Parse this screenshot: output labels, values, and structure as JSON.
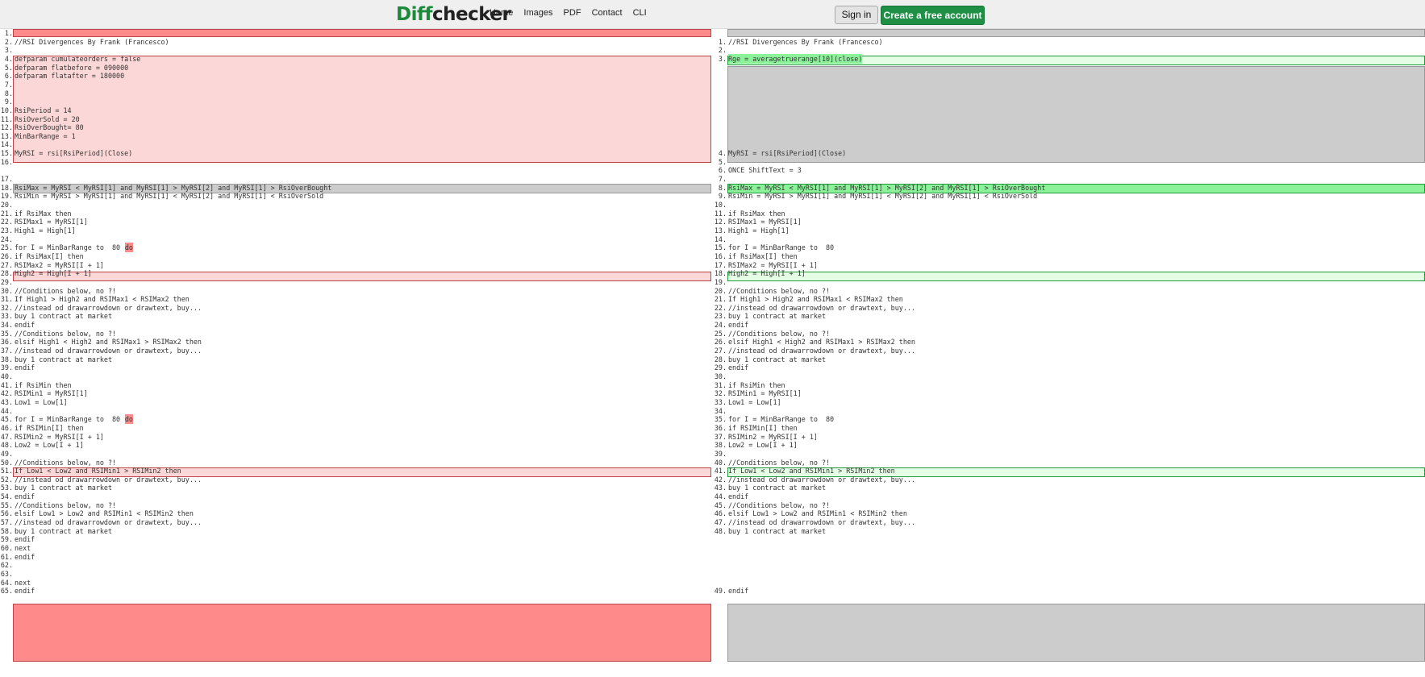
{
  "header": {
    "logo_part1": "Diff",
    "logo_part2": "checker",
    "nav": [
      "Home",
      "Images",
      "PDF",
      "Contact",
      "CLI"
    ],
    "signin_label": "Sign in",
    "create_label": "Create a free account"
  },
  "left_lines": [
    {
      "n": "1.",
      "t": ""
    },
    {
      "n": "2.",
      "t": "//RSI Divergences By Frank (Francesco)"
    },
    {
      "n": "3.",
      "t": ""
    },
    {
      "n": "4.",
      "t": "defparam cumulateorders = false"
    },
    {
      "n": "5.",
      "t": "defparam flatbefore = 090000"
    },
    {
      "n": "6.",
      "t": "defparam flatafter = 180000"
    },
    {
      "n": "7.",
      "t": ""
    },
    {
      "n": "8.",
      "t": ""
    },
    {
      "n": "9.",
      "t": ""
    },
    {
      "n": "10.",
      "t": "RsiPeriod = 14"
    },
    {
      "n": "11.",
      "t": "RsiOverSold = 20"
    },
    {
      "n": "12.",
      "t": "RsiOverBought= 80"
    },
    {
      "n": "13.",
      "t": "MinBarRange = 1"
    },
    {
      "n": "14.",
      "t": ""
    },
    {
      "n": "15.",
      "t": "MyRSI = rsi[RsiPeriod](Close)"
    },
    {
      "n": "16.",
      "t": ""
    },
    {
      "n": "",
      "t": ""
    },
    {
      "n": "17.",
      "t": ""
    },
    {
      "n": "18.",
      "t": "RsiMax = MyRSI < MyRSI[1] and MyRSI[1] > MyRSI[2] and MyRSI[1] > RsiOverBought"
    },
    {
      "n": "19.",
      "t": "RsiMin = MyRSI > MyRSI[1] and MyRSI[1] < MyRSI[2] and MyRSI[1] < RsiOverSold"
    },
    {
      "n": "20.",
      "t": ""
    },
    {
      "n": "21.",
      "t": "if RsiMax then"
    },
    {
      "n": "22.",
      "t": "RSIMax1 = MyRSI[1]"
    },
    {
      "n": "23.",
      "t": "High1 = High[1]"
    },
    {
      "n": "24.",
      "t": ""
    },
    {
      "n": "25.",
      "t": "for I = MinBarRange to  80 ",
      "hl": "do"
    },
    {
      "n": "26.",
      "t": "if RsiMax[I] then"
    },
    {
      "n": "27.",
      "t": "RSIMax2 = MyRSI[I + 1]"
    },
    {
      "n": "28.",
      "t": "High2 = High[I + 1]"
    },
    {
      "n": "29.",
      "t": ""
    },
    {
      "n": "30.",
      "t": "//Conditions below, no ?!"
    },
    {
      "n": "31.",
      "t": "If High1 > High2 and RSIMax1 < RSIMax2 then"
    },
    {
      "n": "32.",
      "t": "//instead od drawarrowdown or drawtext, buy..."
    },
    {
      "n": "33.",
      "t": "buy 1 contract at market"
    },
    {
      "n": "34.",
      "t": "endif"
    },
    {
      "n": "35.",
      "t": "//Conditions below, no ?!"
    },
    {
      "n": "36.",
      "t": "elsif High1 < High2 and RSIMax1 > RSIMax2 then"
    },
    {
      "n": "37.",
      "t": "//instead od drawarrowdown or drawtext, buy..."
    },
    {
      "n": "38.",
      "t": "buy 1 contract at market"
    },
    {
      "n": "39.",
      "t": "endif"
    },
    {
      "n": "40.",
      "t": ""
    },
    {
      "n": "41.",
      "t": "if RsiMin then"
    },
    {
      "n": "42.",
      "t": "RSIMin1 = MyRSI[1]"
    },
    {
      "n": "43.",
      "t": "Low1 = Low[1]"
    },
    {
      "n": "44.",
      "t": ""
    },
    {
      "n": "45.",
      "t": "for I = MinBarRange to  80 ",
      "hl": "do"
    },
    {
      "n": "46.",
      "t": "if RSIMin[I] then"
    },
    {
      "n": "47.",
      "t": "RSIMin2 = MyRSI[I + 1]"
    },
    {
      "n": "48.",
      "t": "Low2 = Low[I + 1]"
    },
    {
      "n": "49.",
      "t": ""
    },
    {
      "n": "50.",
      "t": "//Conditions below, no ?!"
    },
    {
      "n": "51.",
      "t": "If Low1 < Low2 and RSIMin1 > RSIMin2 then"
    },
    {
      "n": "52.",
      "t": "//instead od drawarrowdown or drawtext, buy..."
    },
    {
      "n": "53.",
      "t": "buy 1 contract at market"
    },
    {
      "n": "54.",
      "t": "endif"
    },
    {
      "n": "55.",
      "t": "//Conditions below, no ?!"
    },
    {
      "n": "56.",
      "t": "elsif Low1 > Low2 and RSIMin1 < RSIMin2 then"
    },
    {
      "n": "57.",
      "t": "//instead od drawarrowdown or drawtext, buy..."
    },
    {
      "n": "58.",
      "t": "buy 1 contract at market"
    },
    {
      "n": "59.",
      "t": "endif"
    },
    {
      "n": "60.",
      "t": "next"
    },
    {
      "n": "61.",
      "t": "endif"
    },
    {
      "n": "62.",
      "t": ""
    },
    {
      "n": "63.",
      "t": ""
    },
    {
      "n": "64.",
      "t": "next"
    },
    {
      "n": "65.",
      "t": "endif"
    }
  ],
  "right_lines": [
    {
      "n": "",
      "t": ""
    },
    {
      "n": "1.",
      "t": "//RSI Divergences By Frank (Francesco)"
    },
    {
      "n": "2.",
      "t": ""
    },
    {
      "n": "3.",
      "t": "",
      "hl": "Rge = averagetruerange[10](close)"
    },
    {
      "n": "",
      "t": ""
    },
    {
      "n": "",
      "t": ""
    },
    {
      "n": "",
      "t": ""
    },
    {
      "n": "",
      "t": ""
    },
    {
      "n": "",
      "t": ""
    },
    {
      "n": "",
      "t": ""
    },
    {
      "n": "",
      "t": ""
    },
    {
      "n": "",
      "t": ""
    },
    {
      "n": "",
      "t": ""
    },
    {
      "n": "",
      "t": ""
    },
    {
      "n": "4.",
      "t": "MyRSI = rsi[RsiPeriod](Close)"
    },
    {
      "n": "5.",
      "t": ""
    },
    {
      "n": "6.",
      "t": "ONCE ShiftText = 3"
    },
    {
      "n": "7.",
      "t": ""
    },
    {
      "n": "8.",
      "t": "RsiMax = MyRSI < MyRSI[1] and MyRSI[1] > MyRSI[2] and MyRSI[1] > RsiOverBought"
    },
    {
      "n": "9.",
      "t": "RsiMin = MyRSI > MyRSI[1] and MyRSI[1] < MyRSI[2] and MyRSI[1] < RsiOverSold"
    },
    {
      "n": "10.",
      "t": ""
    },
    {
      "n": "11.",
      "t": "if RsiMax then"
    },
    {
      "n": "12.",
      "t": "RSIMax1 = MyRSI[1]"
    },
    {
      "n": "13.",
      "t": "High1 = High[1]"
    },
    {
      "n": "14.",
      "t": ""
    },
    {
      "n": "15.",
      "t": "for I = MinBarRange to  80"
    },
    {
      "n": "16.",
      "t": "if RsiMax[I] then"
    },
    {
      "n": "17.",
      "t": "RSIMax2 = MyRSI[I + 1]"
    },
    {
      "n": "18.",
      "t": "High2 = High[I + 1]"
    },
    {
      "n": "19.",
      "t": ""
    },
    {
      "n": "20.",
      "t": "//Conditions below, no ?!"
    },
    {
      "n": "21.",
      "t": "If High1 > High2 and RSIMax1 < RSIMax2 then"
    },
    {
      "n": "22.",
      "t": "//instead od drawarrowdown or drawtext, buy..."
    },
    {
      "n": "23.",
      "t": "buy 1 contract at market"
    },
    {
      "n": "24.",
      "t": "endif"
    },
    {
      "n": "25.",
      "t": "//Conditions below, no ?!"
    },
    {
      "n": "26.",
      "t": "elsif High1 < High2 and RSIMax1 > RSIMax2 then"
    },
    {
      "n": "27.",
      "t": "//instead od drawarrowdown or drawtext, buy..."
    },
    {
      "n": "28.",
      "t": "buy 1 contract at market"
    },
    {
      "n": "29.",
      "t": "endif"
    },
    {
      "n": "30.",
      "t": ""
    },
    {
      "n": "31.",
      "t": "if RsiMin then"
    },
    {
      "n": "32.",
      "t": "RSIMin1 = MyRSI[1]"
    },
    {
      "n": "33.",
      "t": "Low1 = Low[1]"
    },
    {
      "n": "34.",
      "t": ""
    },
    {
      "n": "35.",
      "t": "for I = MinBarRange to  80"
    },
    {
      "n": "36.",
      "t": "if RSIMin[I] then"
    },
    {
      "n": "37.",
      "t": "RSIMin2 = MyRSI[I + 1]"
    },
    {
      "n": "38.",
      "t": "Low2 = Low[I + 1]"
    },
    {
      "n": "39.",
      "t": ""
    },
    {
      "n": "40.",
      "t": "//Conditions below, no ?!"
    },
    {
      "n": "41.",
      "t": "If Low1 < Low2 and RSIMin1 > RSIMin2 then"
    },
    {
      "n": "42.",
      "t": "//instead od drawarrowdown or drawtext, buy..."
    },
    {
      "n": "43.",
      "t": "buy 1 contract at market"
    },
    {
      "n": "44.",
      "t": "endif"
    },
    {
      "n": "45.",
      "t": "//Conditions below, no ?!"
    },
    {
      "n": "46.",
      "t": "elsif Low1 > Low2 and RSIMin1 < RSIMin2 then"
    },
    {
      "n": "47.",
      "t": "//instead od drawarrowdown or drawtext, buy..."
    },
    {
      "n": "48.",
      "t": "buy 1 contract at market"
    },
    {
      "n": "",
      "t": ""
    },
    {
      "n": "",
      "t": ""
    },
    {
      "n": "",
      "t": ""
    },
    {
      "n": "",
      "t": ""
    },
    {
      "n": "",
      "t": ""
    },
    {
      "n": "",
      "t": ""
    },
    {
      "n": "49.",
      "t": "endif"
    }
  ]
}
